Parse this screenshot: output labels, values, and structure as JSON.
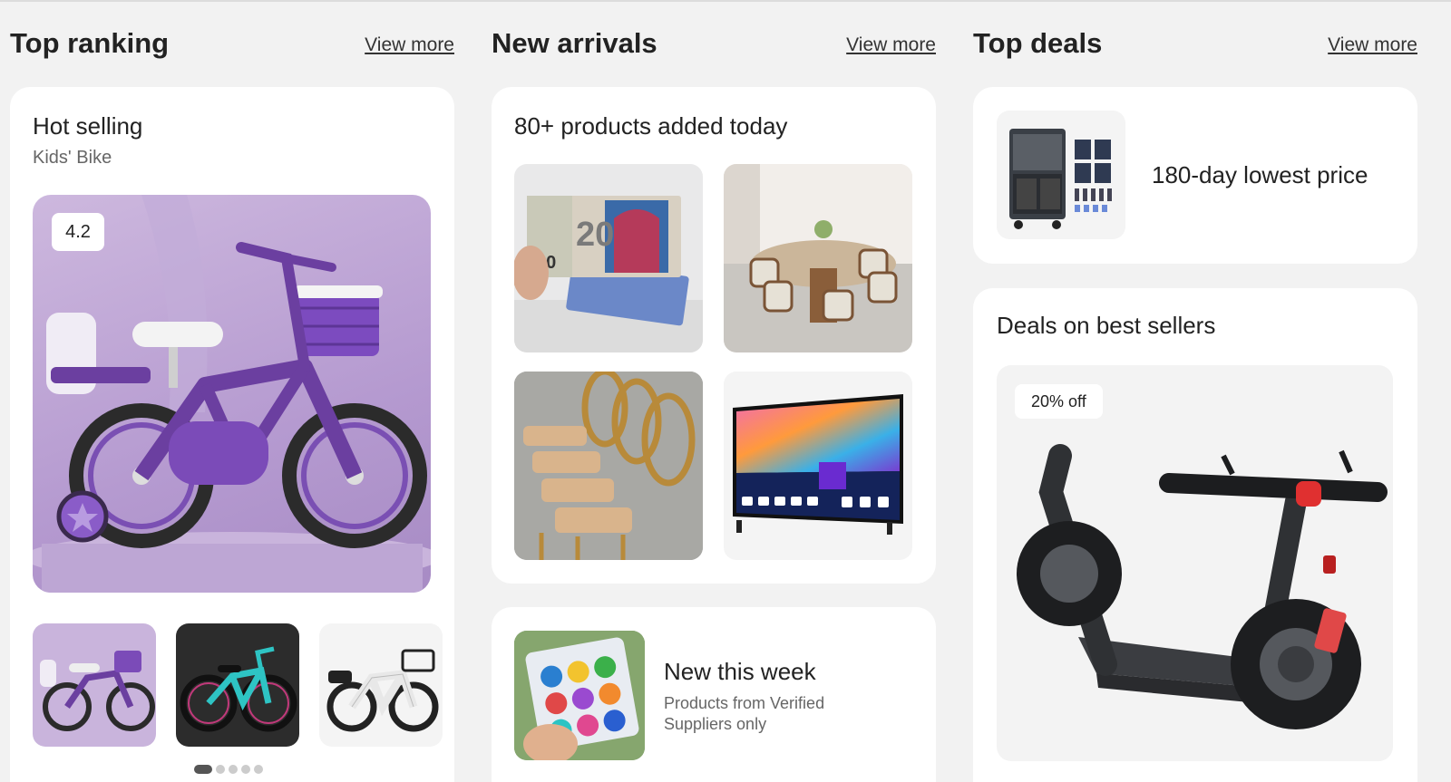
{
  "sections": {
    "top_ranking": {
      "title": "Top ranking",
      "view_more": "View more",
      "card_title": "Hot selling",
      "card_subtitle": "Kids' Bike",
      "rating": "4.2"
    },
    "new_arrivals": {
      "title": "New arrivals",
      "view_more": "View more",
      "card_title": "80+ products added today",
      "week_title": "New this week",
      "week_subtitle_line1": "Products from Verified",
      "week_subtitle_line2": "Suppliers only"
    },
    "top_deals": {
      "title": "Top deals",
      "view_more": "View more",
      "lowest_label": "180-day lowest price",
      "best_title": "Deals on best sellers",
      "discount_badge": "20% off"
    }
  },
  "colors": {
    "page_bg": "#f2f2f2",
    "card_bg": "#ffffff",
    "bike_purple": "#6b3fa0",
    "scooter_accent": "#e03030"
  },
  "icons": [
    "kids-bike-image",
    "euro-banknote-image",
    "dining-table-image",
    "gold-chairs-image",
    "smart-tv-image",
    "toy-pack-image",
    "flight-case-image",
    "electric-scooter-image"
  ]
}
